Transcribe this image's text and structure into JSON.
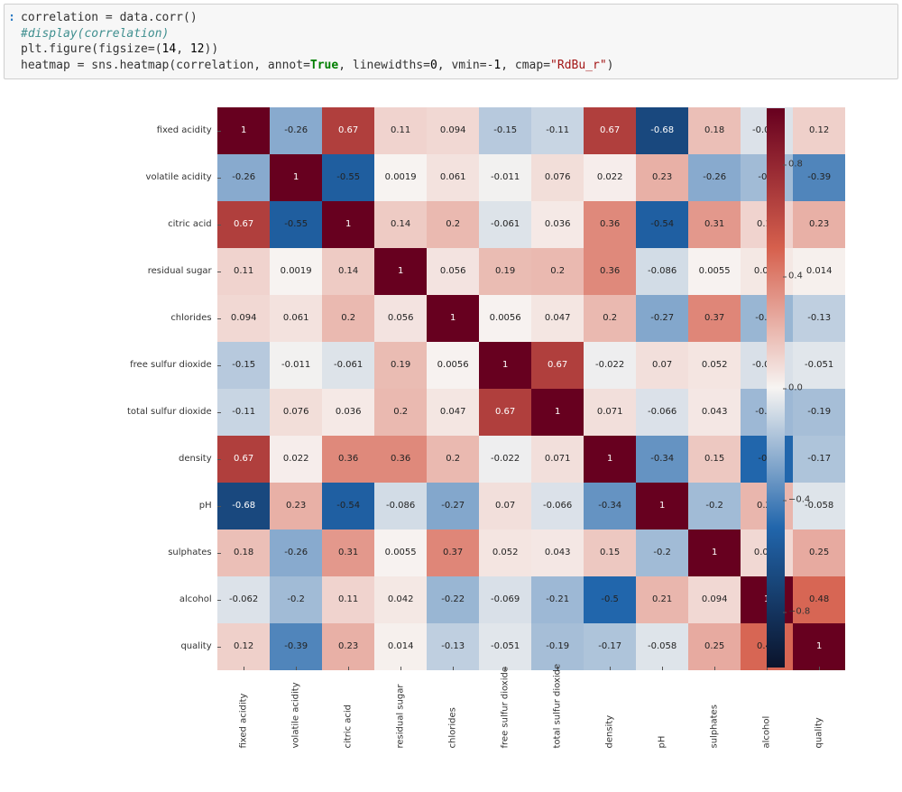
{
  "code": {
    "prompt": ":",
    "line1_pre": "correlation = data.corr()",
    "line2_cmt": "#display(correlation)",
    "line3a": "plt.figure(figsize=(",
    "line3_n1": "14",
    "line3_m": ", ",
    "line3_n2": "12",
    "line3b": "))",
    "line4a": "heatmap = sns.heatmap(correlation, annot=",
    "line4_kw": "True",
    "line4b": ", linewidths=",
    "line4_n0": "0",
    "line4c": ", vmin=-",
    "line4_n1": "1",
    "line4d": ", cmap=",
    "line4_str": "\"RdBu_r\"",
    "line4e": ")"
  },
  "chart_data": {
    "type": "heatmap",
    "labels": [
      "fixed acidity",
      "volatile acidity",
      "citric acid",
      "residual sugar",
      "chlorides",
      "free sulfur dioxide",
      "total sulfur dioxide",
      "density",
      "pH",
      "sulphates",
      "alcohol",
      "quality"
    ],
    "matrix": [
      [
        1,
        -0.26,
        0.67,
        0.11,
        0.094,
        -0.15,
        -0.11,
        0.67,
        -0.68,
        0.18,
        -0.062,
        0.12
      ],
      [
        -0.26,
        1,
        -0.55,
        0.0019,
        0.061,
        -0.011,
        0.076,
        0.022,
        0.23,
        -0.26,
        -0.2,
        -0.39
      ],
      [
        0.67,
        -0.55,
        1,
        0.14,
        0.2,
        -0.061,
        0.036,
        0.36,
        -0.54,
        0.31,
        0.11,
        0.23
      ],
      [
        0.11,
        0.0019,
        0.14,
        1,
        0.056,
        0.19,
        0.2,
        0.36,
        -0.086,
        0.0055,
        0.042,
        0.014
      ],
      [
        0.094,
        0.061,
        0.2,
        0.056,
        1,
        0.0056,
        0.047,
        0.2,
        -0.27,
        0.37,
        -0.22,
        -0.13
      ],
      [
        -0.15,
        -0.011,
        -0.061,
        0.19,
        0.0056,
        1,
        0.67,
        -0.022,
        0.07,
        0.052,
        -0.069,
        -0.051
      ],
      [
        -0.11,
        0.076,
        0.036,
        0.2,
        0.047,
        0.67,
        1,
        0.071,
        -0.066,
        0.043,
        -0.21,
        -0.19
      ],
      [
        0.67,
        0.022,
        0.36,
        0.36,
        0.2,
        -0.022,
        0.071,
        1,
        -0.34,
        0.15,
        -0.5,
        -0.17
      ],
      [
        -0.68,
        0.23,
        -0.54,
        -0.086,
        -0.27,
        0.07,
        -0.066,
        -0.34,
        1,
        -0.2,
        0.21,
        -0.058
      ],
      [
        0.18,
        -0.26,
        0.31,
        0.0055,
        0.37,
        0.052,
        0.043,
        0.15,
        -0.2,
        1,
        0.094,
        0.25
      ],
      [
        -0.062,
        -0.2,
        0.11,
        0.042,
        -0.22,
        -0.069,
        -0.21,
        -0.5,
        0.21,
        0.094,
        1,
        0.48
      ],
      [
        0.12,
        -0.39,
        0.23,
        0.014,
        -0.13,
        -0.051,
        -0.19,
        -0.17,
        -0.058,
        0.25,
        0.48,
        1
      ]
    ],
    "cell_text": [
      [
        "1",
        "-0.26",
        "0.67",
        "0.11",
        "0.094",
        "-0.15",
        "-0.11",
        "0.67",
        "-0.68",
        "0.18",
        "-0.062",
        "0.12"
      ],
      [
        "-0.26",
        "1",
        "-0.55",
        "0.0019",
        "0.061",
        "-0.011",
        "0.076",
        "0.022",
        "0.23",
        "-0.26",
        "-0.2",
        "-0.39"
      ],
      [
        "0.67",
        "-0.55",
        "1",
        "0.14",
        "0.2",
        "-0.061",
        "0.036",
        "0.36",
        "-0.54",
        "0.31",
        "0.11",
        "0.23"
      ],
      [
        "0.11",
        "0.0019",
        "0.14",
        "1",
        "0.056",
        "0.19",
        "0.2",
        "0.36",
        "-0.086",
        "0.0055",
        "0.042",
        "0.014"
      ],
      [
        "0.094",
        "0.061",
        "0.2",
        "0.056",
        "1",
        "0.0056",
        "0.047",
        "0.2",
        "-0.27",
        "0.37",
        "-0.22",
        "-0.13"
      ],
      [
        "-0.15",
        "-0.011",
        "-0.061",
        "0.19",
        "0.0056",
        "1",
        "0.67",
        "-0.022",
        "0.07",
        "0.052",
        "-0.069",
        "-0.051"
      ],
      [
        "-0.11",
        "0.076",
        "0.036",
        "0.2",
        "0.047",
        "0.67",
        "1",
        "0.071",
        "-0.066",
        "0.043",
        "-0.21",
        "-0.19"
      ],
      [
        "0.67",
        "0.022",
        "0.36",
        "0.36",
        "0.2",
        "-0.022",
        "0.071",
        "1",
        "-0.34",
        "0.15",
        "-0.5",
        "-0.17"
      ],
      [
        "-0.68",
        "0.23",
        "-0.54",
        "-0.086",
        "-0.27",
        "0.07",
        "-0.066",
        "-0.34",
        "1",
        "-0.2",
        "0.21",
        "-0.058"
      ],
      [
        "0.18",
        "-0.26",
        "0.31",
        "0.0055",
        "0.37",
        "0.052",
        "0.043",
        "0.15",
        "-0.2",
        "1",
        "0.094",
        "0.25"
      ],
      [
        "-0.062",
        "-0.2",
        "0.11",
        "0.042",
        "-0.22",
        "-0.069",
        "-0.21",
        "-0.5",
        "0.21",
        "0.094",
        "1",
        "0.48"
      ],
      [
        "0.12",
        "-0.39",
        "0.23",
        "0.014",
        "-0.13",
        "-0.051",
        "-0.19",
        "-0.17",
        "-0.058",
        "0.25",
        "0.48",
        "1"
      ]
    ],
    "vmin": -1,
    "vmax": 1,
    "cmap": "RdBu_r",
    "colorbar_ticks": [
      {
        "value": 0.8,
        "label": "0.8"
      },
      {
        "value": 0.4,
        "label": "0.4"
      },
      {
        "value": 0.0,
        "label": "0.0"
      },
      {
        "value": -0.4,
        "label": "−0.4"
      },
      {
        "value": -0.8,
        "label": "−0.8"
      }
    ]
  }
}
